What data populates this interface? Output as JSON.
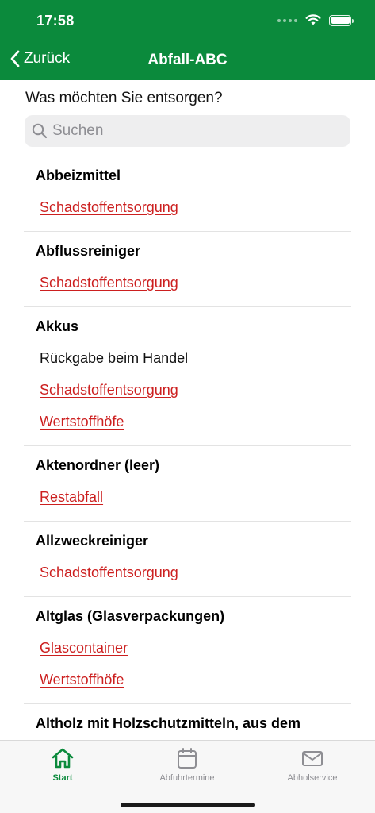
{
  "status": {
    "time": "17:58"
  },
  "nav": {
    "back_label": "Zurück",
    "title": "Abfall-ABC"
  },
  "prompt": "Was möchten Sie entsorgen?",
  "search": {
    "placeholder": "Suchen"
  },
  "entries": [
    {
      "title": "Abbeizmittel",
      "lines": [
        {
          "text": "Schadstoffentsorgung",
          "link": true
        }
      ]
    },
    {
      "title": "Abflussreiniger",
      "lines": [
        {
          "text": "Schadstoffentsorgung",
          "link": true
        }
      ]
    },
    {
      "title": "Akkus",
      "lines": [
        {
          "text": "Rückgabe beim Handel",
          "link": false
        },
        {
          "text": "Schadstoffentsorgung",
          "link": true
        },
        {
          "text": "Wertstoffhöfe",
          "link": true
        }
      ]
    },
    {
      "title": "Aktenordner (leer)",
      "lines": [
        {
          "text": "Restabfall",
          "link": true
        }
      ]
    },
    {
      "title": "Allzweckreiniger",
      "lines": [
        {
          "text": "Schadstoffentsorgung",
          "link": true
        }
      ]
    },
    {
      "title": "Altglas (Glasverpackungen)",
      "lines": [
        {
          "text": "Glascontainer",
          "link": true
        },
        {
          "text": "Wertstoffhöfe",
          "link": true
        }
      ]
    },
    {
      "title": "Altholz mit Holzschutzmitteln, aus dem",
      "lines": []
    }
  ],
  "tabs": [
    {
      "label": "Start",
      "icon": "home-icon",
      "active": true
    },
    {
      "label": "Abfuhrtermine",
      "icon": "calendar-icon",
      "active": false
    },
    {
      "label": "Abholservice",
      "icon": "mail-icon",
      "active": false
    }
  ],
  "colors": {
    "brand_green": "#0b8a3c",
    "link_red": "#cc1f1f",
    "inactive_gray": "#8e8e93"
  }
}
